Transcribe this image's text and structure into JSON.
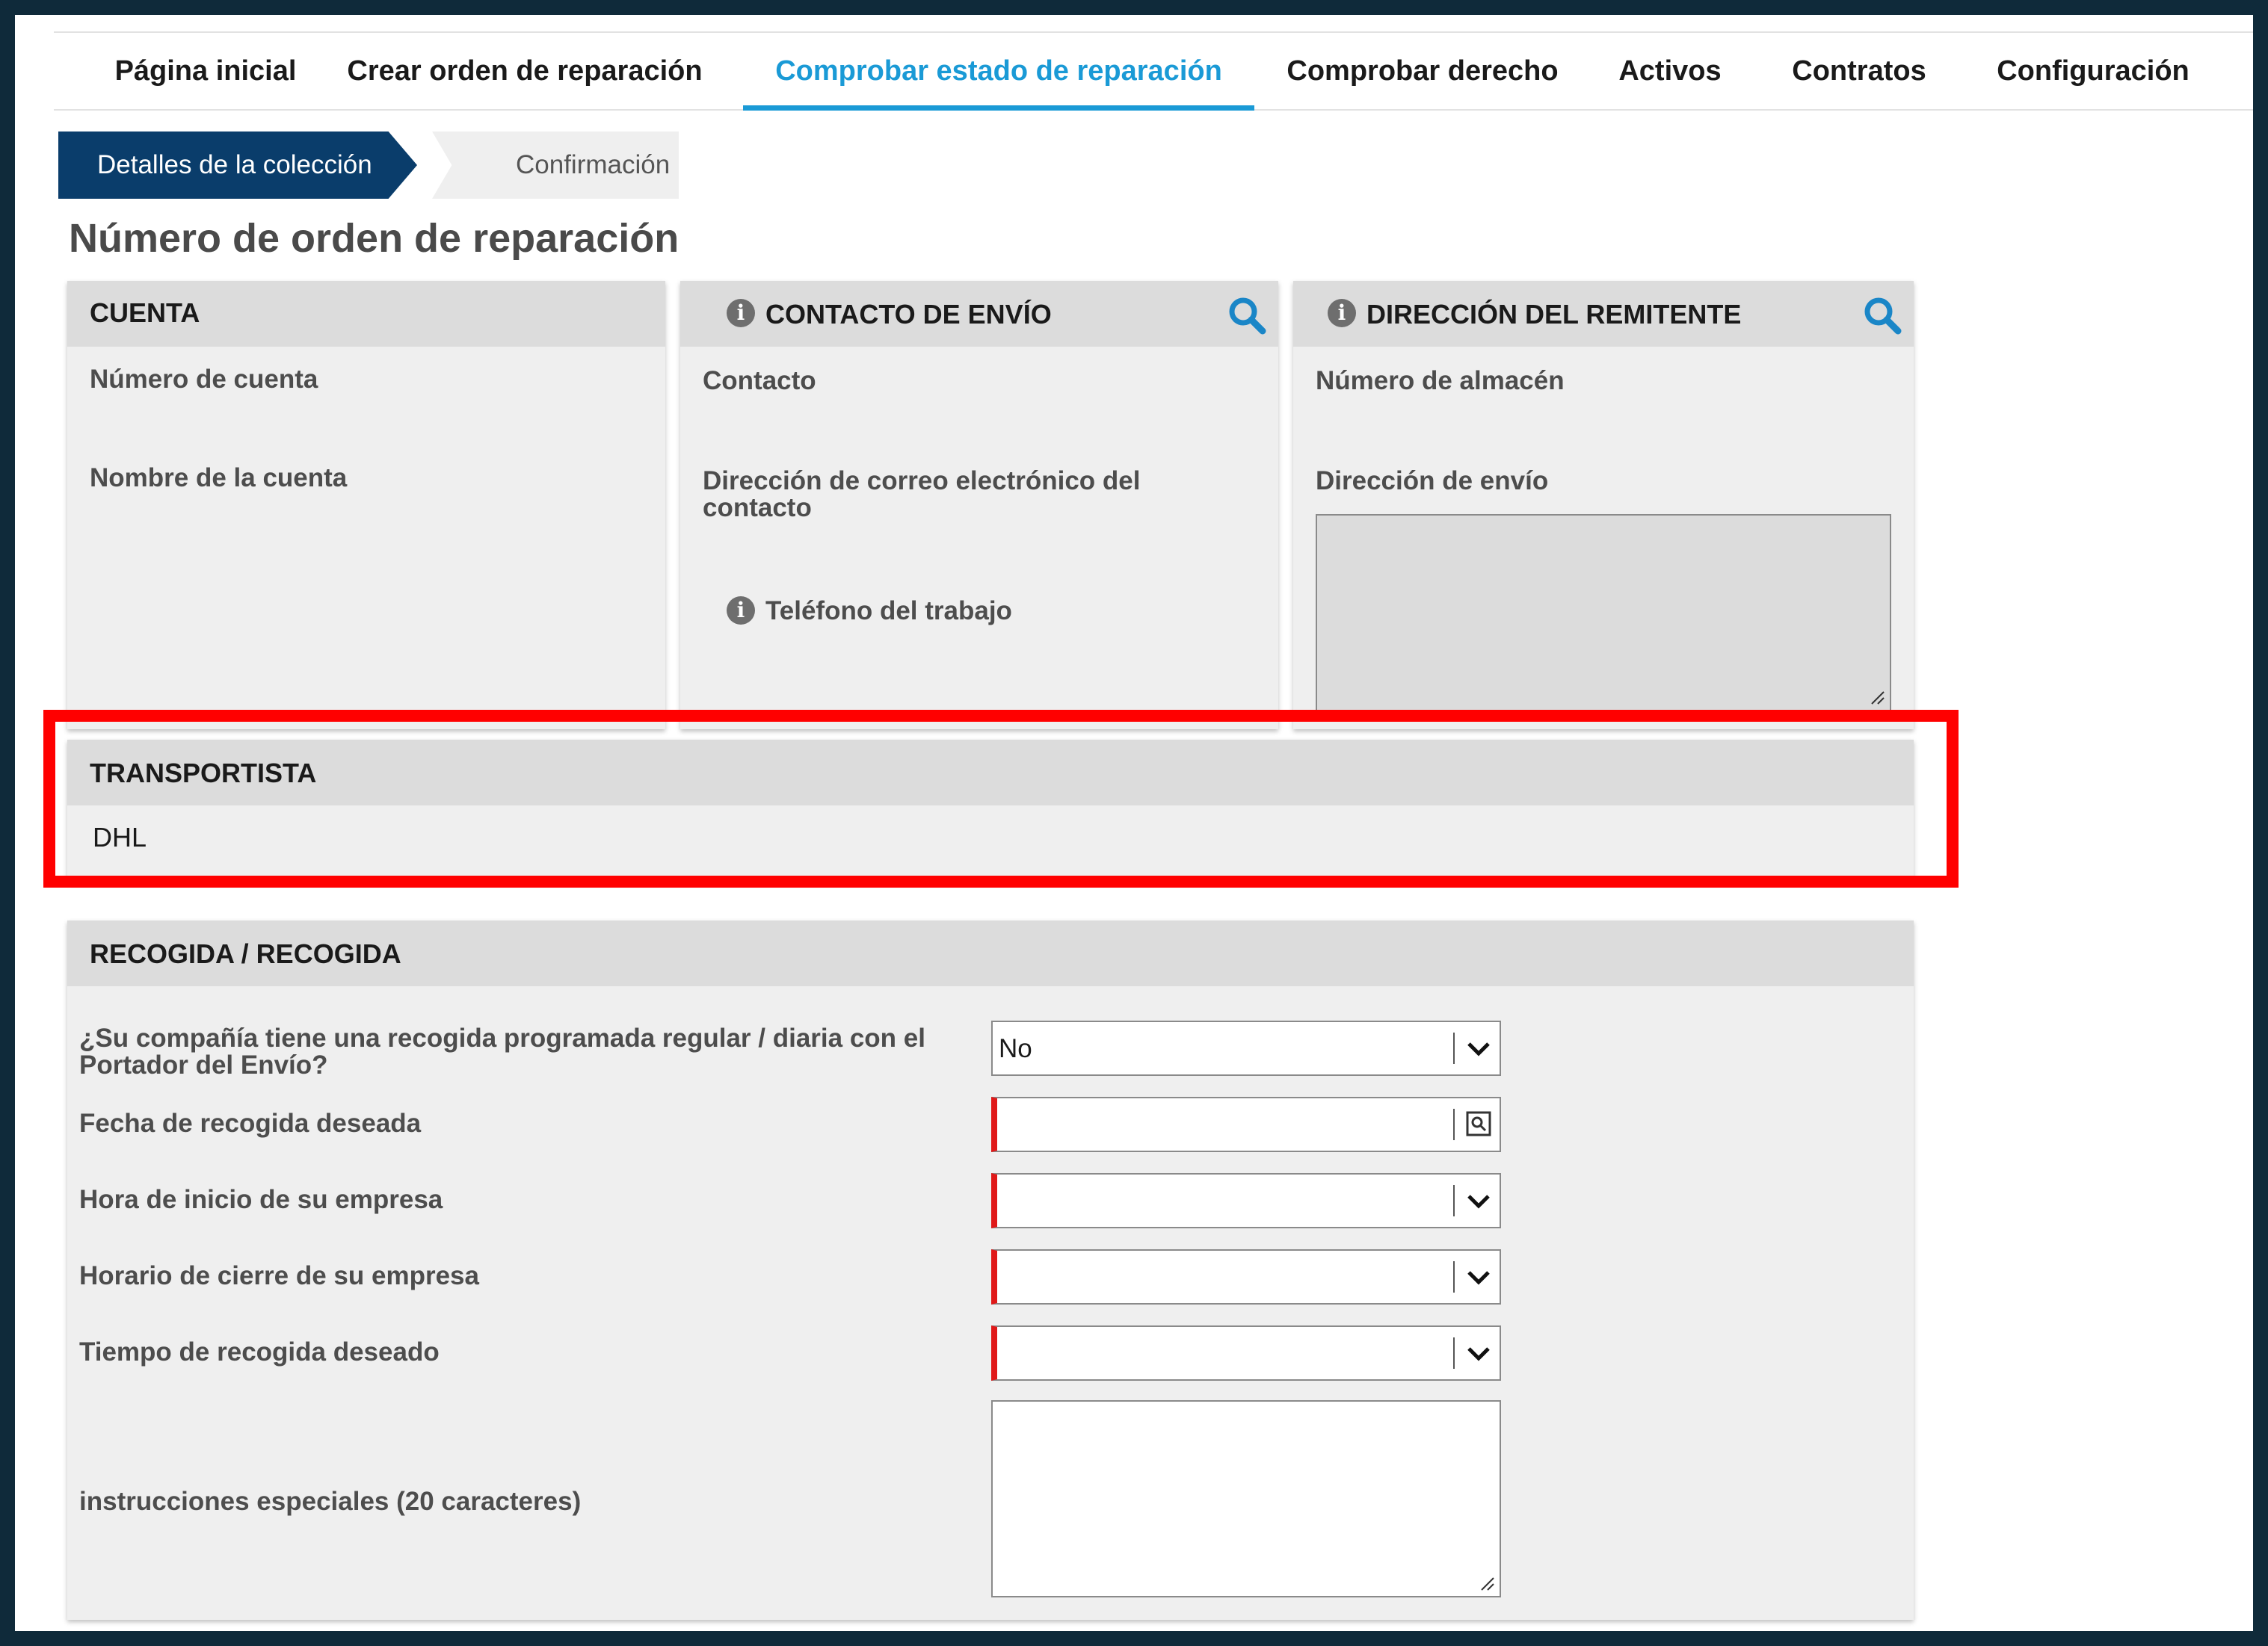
{
  "nav": {
    "items": [
      {
        "label": "Página inicial"
      },
      {
        "label": "Crear orden de reparación"
      },
      {
        "label": "Comprobar estado de reparación"
      },
      {
        "label": "Comprobar derecho"
      },
      {
        "label": "Activos"
      },
      {
        "label": "Contratos"
      },
      {
        "label": "Configuración"
      }
    ],
    "active_index": 2
  },
  "steps": {
    "current": "Detalles de la colección",
    "next": "Confirmación"
  },
  "page_title": "Número de orden de reparación",
  "account_panel": {
    "title": "CUENTA",
    "account_number_label": "Número de cuenta",
    "account_name_label": "Nombre de la cuenta"
  },
  "shipping_contact_panel": {
    "title": "CONTACTO DE ENVÍO",
    "contact_label": "Contacto",
    "email_label": "Dirección de correo electrónico del contacto",
    "phone_label": "Teléfono del trabajo"
  },
  "sender_address_panel": {
    "title": "DIRECCIÓN DEL REMITENTE",
    "warehouse_label": "Número de almacén",
    "shipping_address_label": "Dirección de envío"
  },
  "carrier_panel": {
    "title": "TRANSPORTISTA",
    "value": "DHL"
  },
  "pickup_panel": {
    "title": "RECOGIDA / RECOGIDA",
    "scheduled_pickup_label": "¿Su compañía tiene una recogida programada regular / diaria con el Portador del Envío?",
    "scheduled_pickup_value": "No",
    "pickup_date_label": "Fecha de recogida deseada",
    "open_time_label": "Hora de inicio de su empresa",
    "close_time_label": "Horario de cierre de su empresa",
    "pickup_time_label": "Tiempo de recogida deseado",
    "instructions_label": "instrucciones especiales (20 caracteres)"
  },
  "colors": {
    "accent": "#1a9ad6",
    "step_active": "#0a3d6b",
    "required": "#e01919",
    "highlight": "#ff0000",
    "border_frame": "#0f2a3a"
  }
}
